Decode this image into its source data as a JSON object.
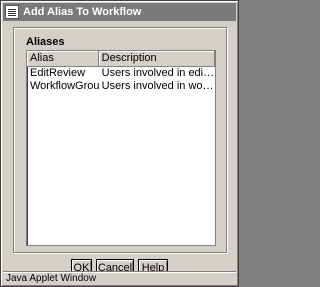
{
  "window": {
    "title": "Add Alias To Workflow",
    "app_icon": "document-icon"
  },
  "aliases": {
    "section_label": "Aliases",
    "columns": [
      "Alias",
      "Description"
    ],
    "rows": [
      {
        "alias": "EditReview",
        "description": "Users involved in edit revi..."
      },
      {
        "alias": "WorkflowGroup",
        "description": "Users involved in workflow"
      }
    ]
  },
  "buttons": {
    "ok": "OK",
    "cancel": "Cancel",
    "help": "Help"
  },
  "status": {
    "text": "Java Applet Window"
  },
  "colors": {
    "window_bg": "#d4d0c8",
    "titlebar_bg": "#7a7a7a",
    "table_bg": "#ffffff"
  }
}
